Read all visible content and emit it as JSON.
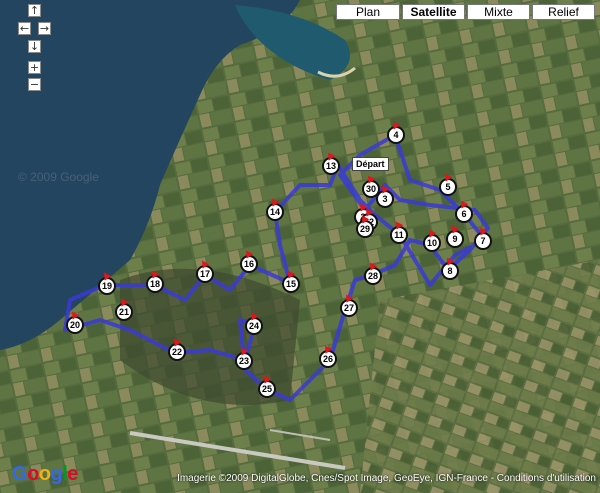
{
  "map_types": [
    {
      "label": "Plan",
      "active": false
    },
    {
      "label": "Satellite",
      "active": true
    },
    {
      "label": "Mixte",
      "active": false
    },
    {
      "label": "Relief",
      "active": false
    }
  ],
  "nav_controls": {
    "pan_up": "↑",
    "pan_left": "←",
    "pan_right": "→",
    "pan_down": "↓",
    "zoom_in": "+",
    "zoom_out": "−"
  },
  "start_label": "Départ",
  "markers": [
    "1",
    "2",
    "3",
    "4",
    "5",
    "6",
    "7",
    "8",
    "9",
    "10",
    "11",
    "12",
    "13",
    "14",
    "15",
    "16",
    "17",
    "18",
    "19",
    "20",
    "21",
    "22",
    "23",
    "24",
    "25",
    "26",
    "27",
    "28",
    "29",
    "30"
  ],
  "watermark": "© 2009 Google",
  "copyright": "Imagerie ©2009 DigitalGlobe, Cnes/Spot Image, GeoEye, IGN-France - Conditions d'utilisation",
  "logo": {
    "letters": [
      "G",
      "o",
      "o",
      "g",
      "l",
      "e"
    ],
    "colors": [
      "#3369e8",
      "#d50f25",
      "#eeb211",
      "#3369e8",
      "#009925",
      "#d50f25"
    ]
  },
  "colors": {
    "sea": "#24455f",
    "land": "#4b5a37",
    "route": "#3a3ad6"
  }
}
